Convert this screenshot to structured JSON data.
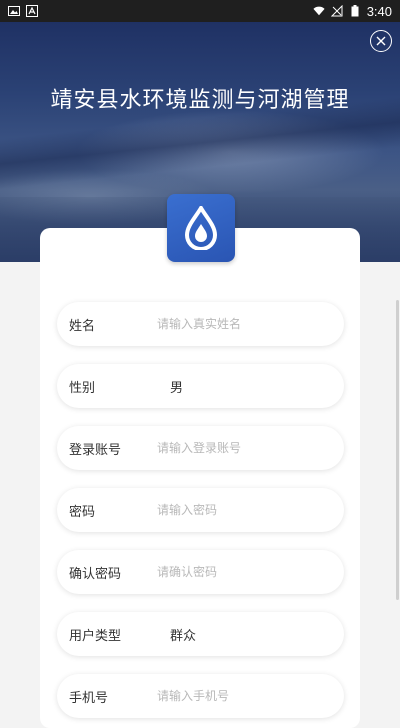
{
  "status_bar": {
    "time": "3:40",
    "left_icons": [
      "image-icon",
      "text-icon"
    ],
    "right_icons": [
      "wifi-icon",
      "signal-icon",
      "battery-icon"
    ]
  },
  "header": {
    "title": "靖安县水环境监测与河湖管理"
  },
  "form": {
    "fields": [
      {
        "label": "姓名",
        "placeholder": "请输入真实姓名",
        "value": ""
      },
      {
        "label": "性别",
        "placeholder": "",
        "value": "男"
      },
      {
        "label": "登录账号",
        "placeholder": "请输入登录账号",
        "value": ""
      },
      {
        "label": "密码",
        "placeholder": "请输入密码",
        "value": ""
      },
      {
        "label": "确认密码",
        "placeholder": "请确认密码",
        "value": ""
      },
      {
        "label": "用户类型",
        "placeholder": "",
        "value": "群众"
      },
      {
        "label": "手机号",
        "placeholder": "请输入手机号",
        "value": ""
      }
    ]
  },
  "colors": {
    "accent": "#2f5fbf",
    "background": "#f3f3f3",
    "hero": "#2b4275"
  }
}
